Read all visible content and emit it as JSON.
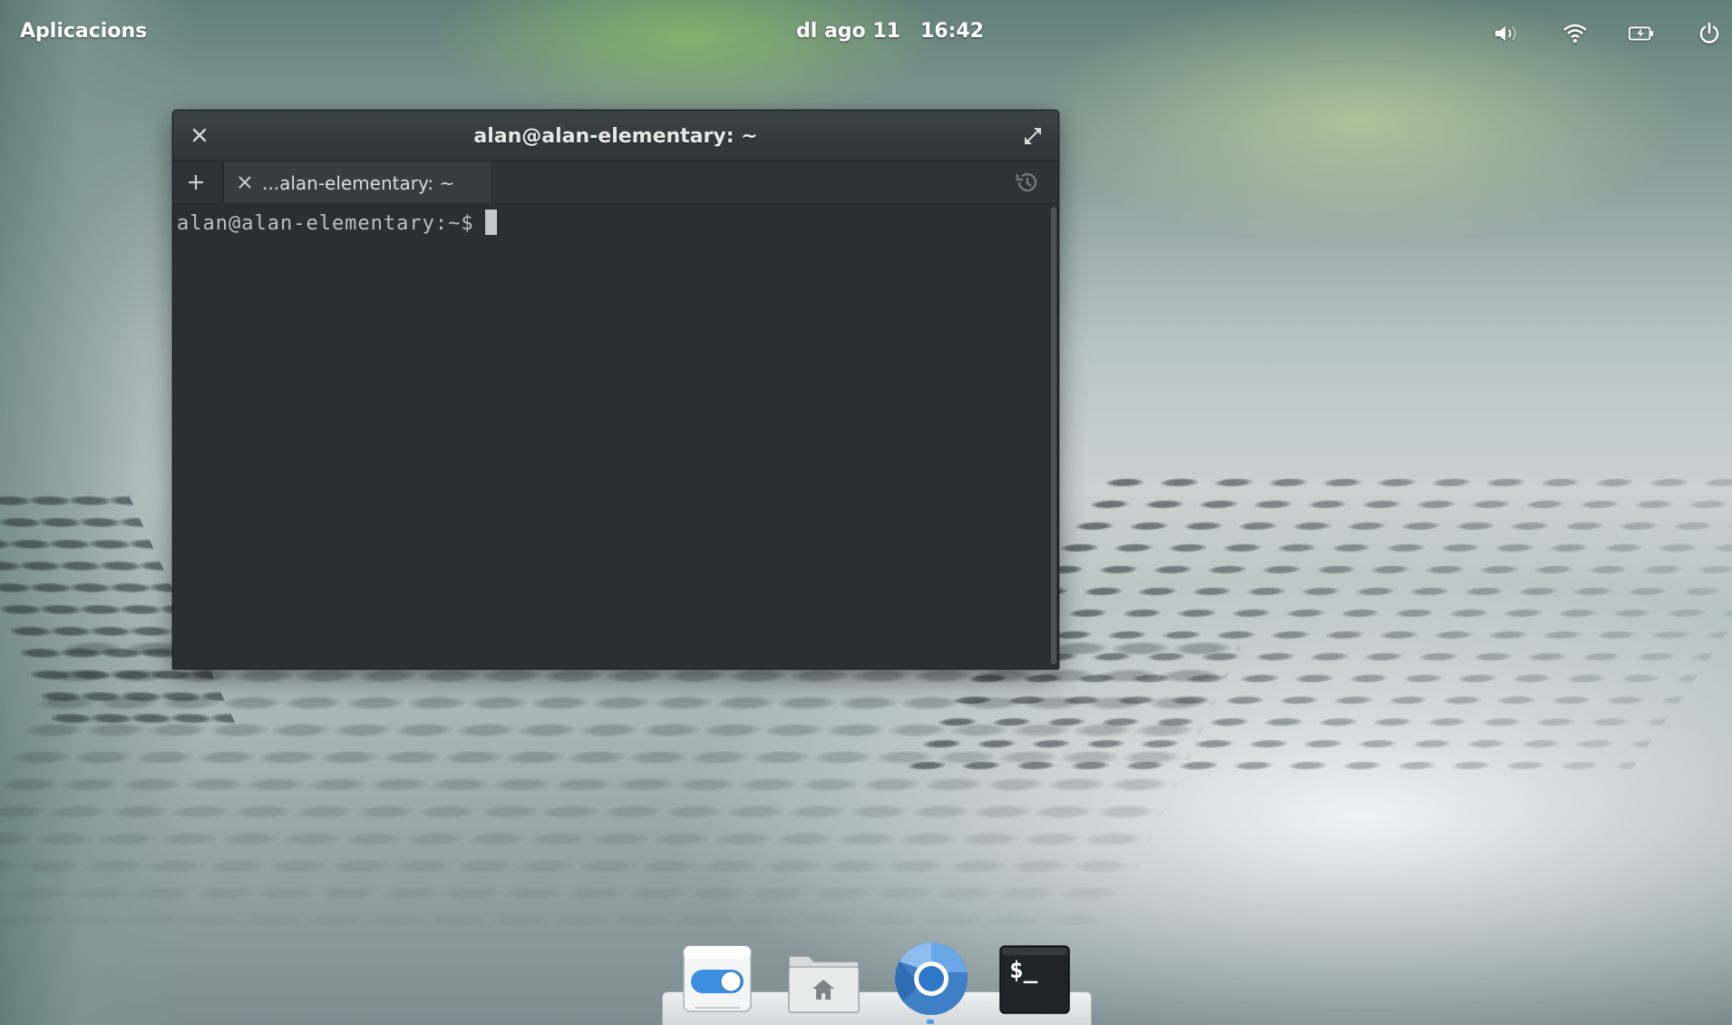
{
  "panel": {
    "applications_label": "Aplicacions",
    "date": "dl ago 11",
    "time": "16:42",
    "indicators": [
      "volume-icon",
      "wifi-icon",
      "battery-icon",
      "power-icon"
    ]
  },
  "terminal": {
    "title": "alan@alan-elementary: ~",
    "tabs": [
      {
        "label": "...alan-elementary: ~"
      }
    ],
    "prompt": "alan@alan-elementary:~$"
  },
  "dock": {
    "items": [
      "switchboard-settings-icon",
      "files-home-icon",
      "chromium-icon",
      "terminal-icon"
    ],
    "terminal_icon_text": "$_"
  },
  "colors": {
    "terminal_bg": "#2a3133",
    "prompt_text": "#b9c0c2",
    "accent": "#4aa0e0"
  }
}
